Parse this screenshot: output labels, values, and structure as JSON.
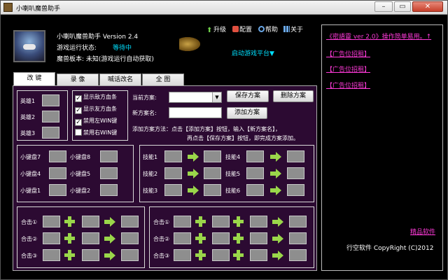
{
  "window": {
    "title": "小喇叭魔兽助手"
  },
  "header": {
    "app_name": "小喇叭魔兽助手 Version 2.4",
    "game_status_label": "游戏运行状态:",
    "game_status_value": "等待中",
    "warcraft_version": "魔兽板本: 未知(游戏运行自动获取)",
    "upgrade": "升级",
    "config": "配置",
    "help": "帮助",
    "about": "关于",
    "launch_platform": "启动游戏平台▼"
  },
  "tabs": [
    "改 键",
    "录 像",
    "喊话改名",
    "全 图"
  ],
  "heroes": [
    "英雄1",
    "英雄2",
    "英雄3"
  ],
  "options": [
    {
      "label": "显示敌方血条",
      "checked": "✓"
    },
    {
      "label": "显示友方血条",
      "checked": "✓"
    },
    {
      "label": "禁用左WIN键",
      "checked": "✓"
    },
    {
      "label": "禁用右WIN键",
      "checked": ""
    }
  ],
  "scheme": {
    "current_label": "当前方案:",
    "new_label": "新方案名:",
    "save_btn": "保存方案",
    "delete_btn": "删除方案",
    "add_btn": "添加方案",
    "hint1": "添加方案方法：点击【添加方案】按钮，输入【新方案名】，",
    "hint2": "再点击【保存方案】按钮，即完成方案添加。"
  },
  "keypad": [
    "小键盘7",
    "小键盘8",
    "小键盘4",
    "小键盘5",
    "小键盘1",
    "小键盘2"
  ],
  "skills": [
    "技能1",
    "技能2",
    "技能3",
    "技能4",
    "技能5",
    "技能6"
  ],
  "combos": [
    "合击①",
    "合击②",
    "合击③"
  ],
  "sidebar": {
    "ad_top": "《密語靈 ver 2.0》操作简单易用。↑",
    "ads": [
      "【广告位招租】",
      "【广告位招租】",
      "【广告位招租】"
    ],
    "premium": "精品软件",
    "copyright": "行空软件 CopyRight (C)2012"
  },
  "colors": {
    "panel": "#2c0a32",
    "accent_cyan": "#00e0ff",
    "link_pink": "#ff3ad9",
    "arrow_green": "#9ad64a"
  }
}
